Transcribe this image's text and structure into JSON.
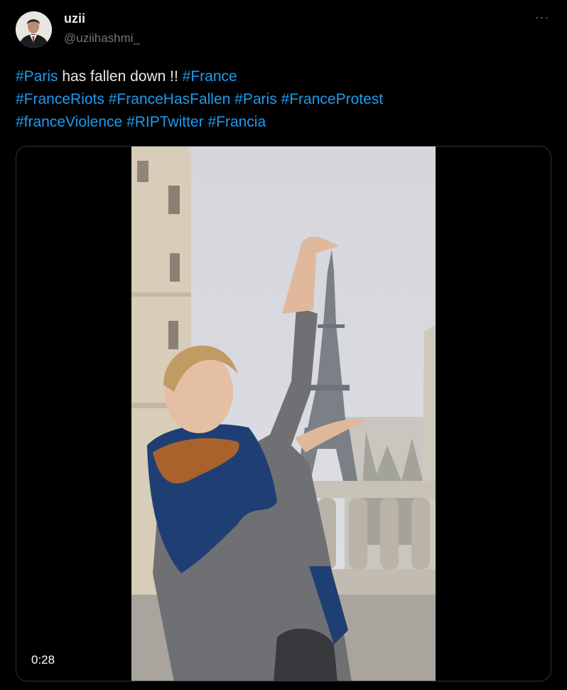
{
  "author": {
    "display_name": "uzii",
    "handle": "@uziihashmi_"
  },
  "menu": {
    "more_label": "···"
  },
  "tweet": {
    "lines": [
      [
        {
          "text": "#Paris",
          "type": "hashtag"
        },
        {
          "text": " has fallen down !! ",
          "type": "plain"
        },
        {
          "text": "#France",
          "type": "hashtag"
        }
      ],
      [
        {
          "text": "#FranceRiots",
          "type": "hashtag"
        },
        {
          "text": " ",
          "type": "plain"
        },
        {
          "text": "#FranceHasFallen",
          "type": "hashtag"
        },
        {
          "text": " ",
          "type": "plain"
        },
        {
          "text": "#Paris",
          "type": "hashtag"
        },
        {
          "text": " ",
          "type": "plain"
        },
        {
          "text": "#FranceProtest",
          "type": "hashtag"
        }
      ],
      [
        {
          "text": "#franceViolence",
          "type": "hashtag"
        },
        {
          "text": " ",
          "type": "plain"
        },
        {
          "text": "#RIPTwitter",
          "type": "hashtag"
        },
        {
          "text": " ",
          "type": "plain"
        },
        {
          "text": "#Francia",
          "type": "hashtag"
        }
      ]
    ]
  },
  "video": {
    "duration": "0:28"
  },
  "colors": {
    "link": "#1d9bf0",
    "text": "#e7e9ea",
    "muted": "#71767b",
    "border": "#2f3336"
  }
}
